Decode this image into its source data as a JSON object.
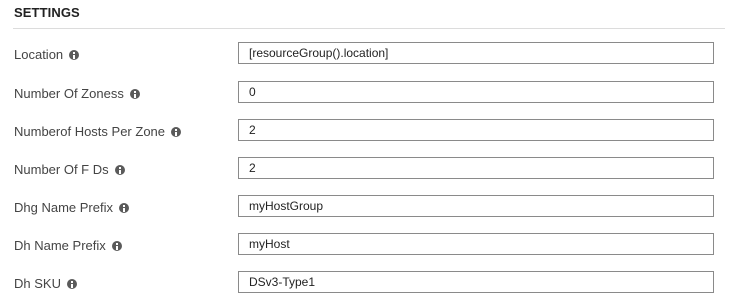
{
  "section": {
    "title": "SETTINGS"
  },
  "fields": [
    {
      "label": "Location",
      "value": "[resourceGroup().location]"
    },
    {
      "label": "Number Of Zoness",
      "value": "0"
    },
    {
      "label": "Numberof Hosts Per Zone",
      "value": "2"
    },
    {
      "label": "Number Of F Ds",
      "value": "2"
    },
    {
      "label": "Dhg Name Prefix",
      "value": "myHostGroup"
    },
    {
      "label": "Dh Name Prefix",
      "value": "myHost"
    },
    {
      "label": "Dh SKU",
      "value": "DSv3-Type1"
    }
  ],
  "icons": {
    "info": "info-icon"
  }
}
